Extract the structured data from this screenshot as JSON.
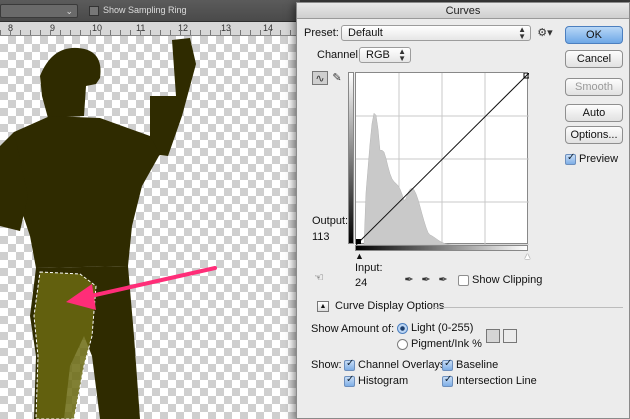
{
  "ps": {
    "options_bar": {
      "show_sampling_ring_label": "Show Sampling Ring",
      "show_sampling_ring_checked": false
    },
    "ruler": {
      "labels": [
        "8",
        "9",
        "10",
        "11",
        "12",
        "13",
        "14"
      ]
    }
  },
  "dialog": {
    "title": "Curves",
    "preset": {
      "label": "Preset:",
      "value": "Default"
    },
    "channel": {
      "label": "Channel:",
      "value": "RGB"
    },
    "buttons": {
      "ok": "OK",
      "cancel": "Cancel",
      "smooth": "Smooth",
      "auto": "Auto",
      "options": "Options..."
    },
    "preview": {
      "label": "Preview",
      "checked": true
    },
    "output": {
      "label": "Output:",
      "value": "113"
    },
    "input": {
      "label": "Input:",
      "value": "24"
    },
    "show_clipping": {
      "label": "Show Clipping",
      "checked": false
    },
    "curve_display_options": "Curve Display Options",
    "show_amount": {
      "label": "Show Amount of:",
      "light": "Light  (0-255)",
      "pigment": "Pigment/Ink %",
      "selected": "light"
    },
    "show": {
      "label": "Show:",
      "channel_overlays": "Channel Overlays",
      "baseline": "Baseline",
      "histogram": "Histogram",
      "intersection_line": "Intersection Line"
    }
  },
  "colors": {
    "accent_arrow": "#ff2d78",
    "ok_button": "#6ea7e6",
    "selection_tint": "#3b3800"
  }
}
